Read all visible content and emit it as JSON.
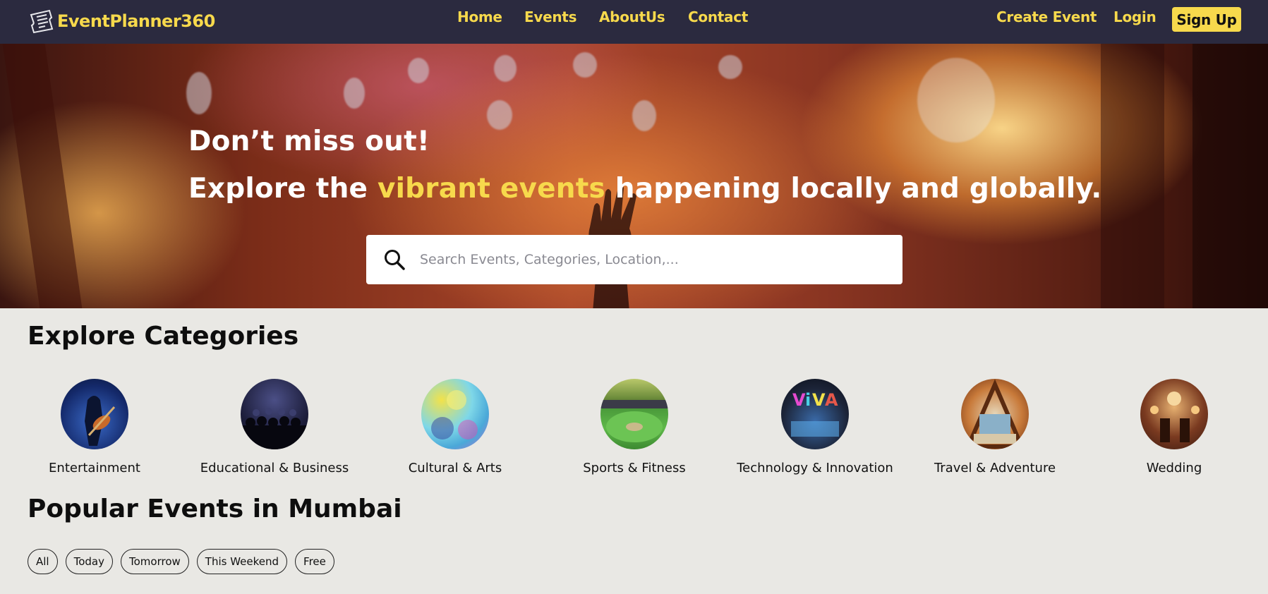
{
  "brand": {
    "name": "EventPlanner360",
    "icon": "ticket-icon"
  },
  "nav": {
    "links": [
      "Home",
      "Events",
      "AboutUs",
      "Contact"
    ],
    "create_event": "Create Event",
    "login": "Login",
    "signup": "Sign Up"
  },
  "hero": {
    "title_line1": "Don’t miss out!",
    "title_line2_prefix": "Explore the ",
    "title_line2_highlight": "vibrant events",
    "title_line2_suffix": " happening locally and globally.",
    "search_placeholder": "Search Events, Categories, Location,..."
  },
  "categories": {
    "title": "Explore Categories",
    "items": [
      "Entertainment",
      "Educational & Business",
      "Cultural & Arts",
      "Sports & Fitness",
      "Technology & Innovation",
      "Travel & Adventure",
      "Wedding"
    ]
  },
  "popular": {
    "title": "Popular Events in Mumbai",
    "filters": [
      "All",
      "Today",
      "Tomorrow",
      "This Weekend",
      "Free"
    ]
  },
  "colors": {
    "nav_bg": "#2b2a3f",
    "accent": "#f7d94c",
    "page_bg": "#e9e8e4"
  }
}
